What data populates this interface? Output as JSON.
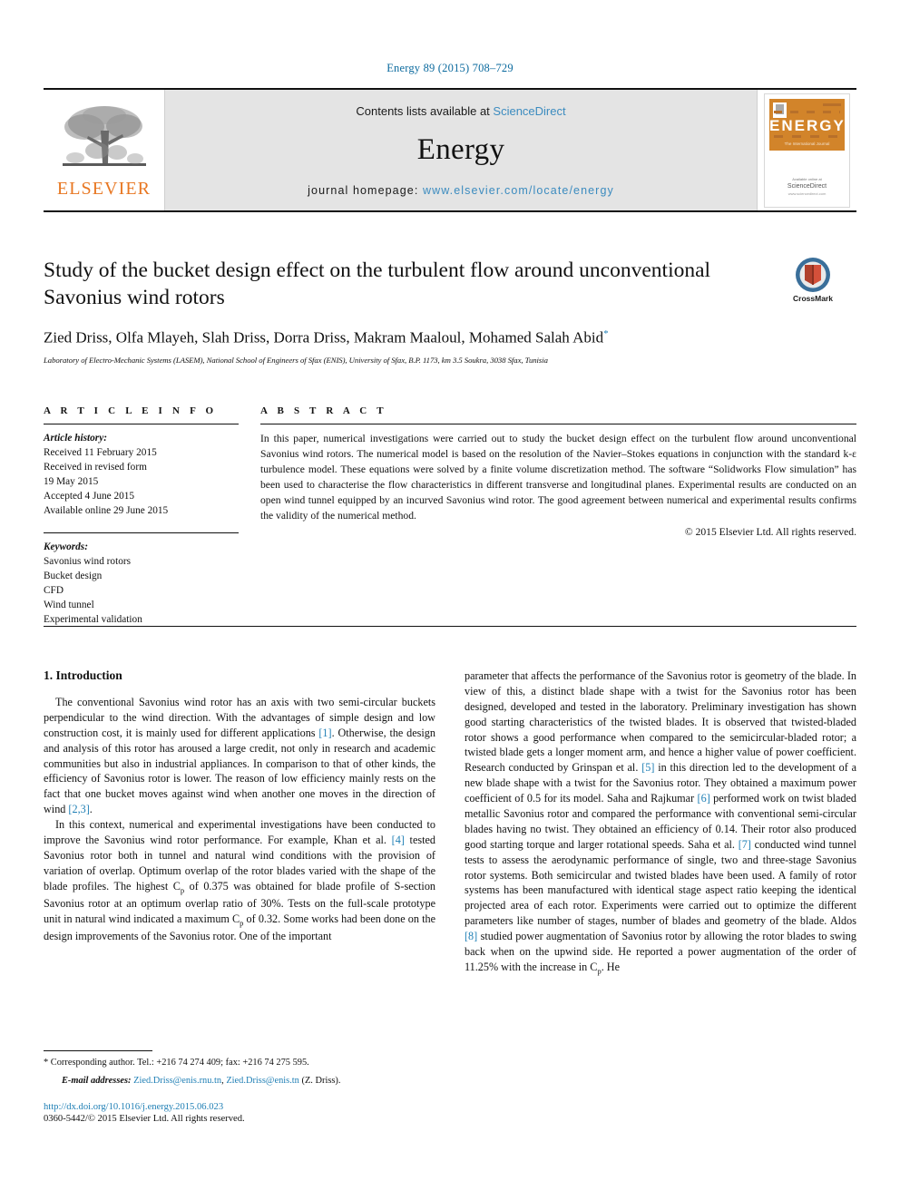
{
  "running_head": "Energy 89 (2015) 708–729",
  "masthead": {
    "publisher_name": "ELSEVIER",
    "contents_prefix": "Contents lists available at ",
    "contents_link": "ScienceDirect",
    "journal_name": "Energy",
    "homepage_prefix": "journal homepage: ",
    "homepage_url": "www.elsevier.com/locate/energy",
    "cover": {
      "title": "ENERGY",
      "subtitle": "The International Journal",
      "footer_line1": "Available online at",
      "footer_line2": "ScienceDirect",
      "footer_line3": "www.sciencedirect.com"
    }
  },
  "article": {
    "title": "Study of the bucket design effect on the turbulent flow around unconventional Savonius wind rotors",
    "authors": "Zied Driss, Olfa Mlayeh, Slah Driss, Dorra Driss, Makram Maaloul, Mohamed Salah Abid",
    "author_marker": "*",
    "affiliation": "Laboratory of Electro-Mechanic Systems (LASEM), National School of Engineers of Sfax (ENIS), University of Sfax, B.P. 1173, km 3.5 Soukra, 3038 Sfax, Tunisia",
    "crossmark_label": "CrossMark"
  },
  "article_info": {
    "heading": "A R T I C L E  I N F O",
    "history_label": "Article history:",
    "history": [
      "Received 11 February 2015",
      "Received in revised form",
      "19 May 2015",
      "Accepted 4 June 2015",
      "Available online 29 June 2015"
    ],
    "keywords_label": "Keywords:",
    "keywords": [
      "Savonius wind rotors",
      "Bucket design",
      "CFD",
      "Wind tunnel",
      "Experimental validation"
    ]
  },
  "abstract": {
    "heading": "A B S T R A C T",
    "text": "In this paper, numerical investigations were carried out to study the bucket design effect on the turbulent flow around unconventional Savonius wind rotors. The numerical model is based on the resolution of the Navier–Stokes equations in conjunction with the standard k-ε turbulence model. These equations were solved by a finite volume discretization method. The software “Solidworks Flow simulation” has been used to characterise the flow characteristics in different transverse and longitudinal planes. Experimental results are conducted on an open wind tunnel equipped by an incurved Savonius wind rotor. The good agreement between numerical and experimental results confirms the validity of the numerical method.",
    "copyright": "© 2015 Elsevier Ltd. All rights reserved."
  },
  "body": {
    "section_heading": "1. Introduction",
    "left_paragraph_1_a": "The conventional Savonius wind rotor has an axis with two semi-circular buckets perpendicular to the wind direction. With the advantages of simple design and low construction cost, it is mainly used for different applications ",
    "left_ref_1": "[1]",
    "left_paragraph_1_b": ". Otherwise, the design and analysis of this rotor has aroused a large credit, not only in research and academic communities but also in industrial appliances. In comparison to that of other kinds, the efficiency of Savonius rotor is lower. The reason of low efficiency mainly rests on the fact that one bucket moves against wind when another one moves in the direction of wind ",
    "left_ref_2": "[2,3]",
    "left_paragraph_1_c": ".",
    "left_paragraph_2_a": "In this context, numerical and experimental investigations have been conducted to improve the Savonius wind rotor performance. For example, Khan et al. ",
    "left_ref_3": "[4]",
    "left_paragraph_2_b": " tested Savonius rotor both in tunnel and natural wind conditions with the provision of variation of overlap. Optimum overlap of the rotor blades varied with the shape of the blade profiles. The highest C",
    "left_sub_1": "p",
    "left_paragraph_2_c": " of 0.375 was obtained for blade profile of S-section Savonius rotor at an optimum overlap ratio of 30%. Tests on the full-scale prototype unit in natural wind indicated a maximum C",
    "left_sub_2": "p",
    "left_paragraph_2_d": " of 0.32. Some works had been done on the design improvements of the Savonius rotor. One of the important",
    "right_paragraph_a": "parameter that affects the performance of the Savonius rotor is geometry of the blade. In view of this, a distinct blade shape with a twist for the Savonius rotor has been designed, developed and tested in the laboratory. Preliminary investigation has shown good starting characteristics of the twisted blades. It is observed that twisted-bladed rotor shows a good performance when compared to the semicircular-bladed rotor; a twisted blade gets a longer moment arm, and hence a higher value of power coefficient. Research conducted by Grinspan et al. ",
    "right_ref_5": "[5]",
    "right_paragraph_b": " in this direction led to the development of a new blade shape with a twist for the Savonius rotor. They obtained a maximum power coefficient of 0.5 for its model. Saha and Rajkumar ",
    "right_ref_6": "[6]",
    "right_paragraph_c": " performed work on twist bladed metallic Savonius rotor and compared the performance with conventional semi-circular blades having no twist. They obtained an efficiency of 0.14. Their rotor also produced good starting torque and larger rotational speeds. Saha et al. ",
    "right_ref_7": "[7]",
    "right_paragraph_d": " conducted wind tunnel tests to assess the aerodynamic performance of single, two and three-stage Savonius rotor systems. Both semicircular and twisted blades have been used. A family of rotor systems has been manufactured with identical stage aspect ratio keeping the identical projected area of each rotor. Experiments were carried out to optimize the different parameters like number of stages, number of blades and geometry of the blade. Aldos ",
    "right_ref_8": "[8]",
    "right_paragraph_e": " studied power augmentation of Savonius rotor by allowing the rotor blades to swing back when on the upwind side. He reported a power augmentation of the order of 11.25% with the increase in C",
    "right_sub_1": "p",
    "right_paragraph_f": ". He"
  },
  "footnote": {
    "corresponding": "* Corresponding author. Tel.: +216 74 274 409; fax: +216 74 275 595.",
    "email_label": "E-mail addresses:",
    "email_1": "Zied.Driss@enis.rnu.tn",
    "email_sep": ", ",
    "email_2": "Zied.Driss@enis.tn",
    "email_suffix": " (Z. Driss)."
  },
  "doc_footer": {
    "doi": "http://dx.doi.org/10.1016/j.energy.2015.06.023",
    "issn": "0360-5442/© 2015 Elsevier Ltd. All rights reserved."
  },
  "colors": {
    "link": "#1f7fb5",
    "sciencedirect": "#3b8bbf",
    "elsevier_orange": "#e87722",
    "banner_grey": "#e4e4e4"
  }
}
